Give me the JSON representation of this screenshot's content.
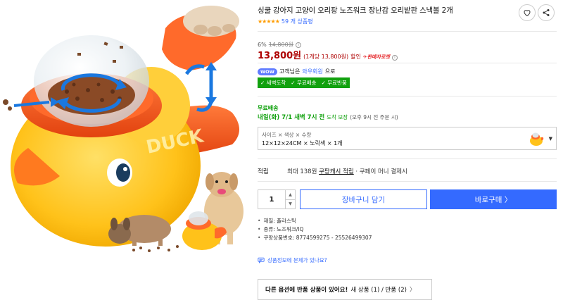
{
  "product": {
    "title": "싱쿨 강아지 고양이 오리팡 노즈워크 장난감 오리밭판 스낵볼 2개",
    "rating_stars": "★★★★★",
    "review_count": "59 개 상품평"
  },
  "icons": {
    "wishlist": "heart-icon",
    "share": "share-icon",
    "info": "info-icon",
    "chevron": "chevron-right-icon",
    "report": "chat-icon"
  },
  "price": {
    "discount_rate": "6%",
    "original_price": "14,800원",
    "sale_price": "13,800원",
    "unit_price": "(1개당 13,800원)",
    "discount_word": "할인",
    "rocket_badge": "✈판매자로켓"
  },
  "wow": {
    "badge": "WOW",
    "prefix": "고객님은",
    "link": "와우회원",
    "suffix": "으로"
  },
  "benefits": [
    "새벽도착",
    "무료배송",
    "무료반품"
  ],
  "shipping": {
    "label": "무료배송",
    "date": "내일(화) 7/1 새벽 7시 전",
    "guarantee": "도착 보장",
    "condition": "(오후 9시 전 주문 시)"
  },
  "option": {
    "header": "사이즈 × 색상 × 수량",
    "value": "12×12×24CM × 노락색 × 1개"
  },
  "cashback": {
    "label": "적립",
    "prefix": "최대 138원",
    "link": "쿠팡캐시 적립",
    "suffix": "· 쿠페이 머니 결제시"
  },
  "purchase": {
    "quantity": "1",
    "cart_label": "장바구니 담기",
    "buy_label": "바로구매 〉"
  },
  "specs": [
    "재질: 플라스틱",
    "종류: 노즈워크/IQ",
    "쿠팡상품번호: 8774599275 - 25526499307"
  ],
  "report_text": "상품정보에 문제가 있나요?",
  "other_options": {
    "bold_text": "다른 옵션에 반품 상품이 있어요!",
    "detail": "새 상품 (1) / 반품 (2)",
    "caret": "〉"
  },
  "image_text": {
    "duck_label": "DUCK"
  },
  "colors": {
    "price_red": "#ae0000",
    "link_blue": "#346aff",
    "rocket_green": "#11a10e",
    "duck_yellow": "#ffc21a",
    "duck_orange": "#ff5a1f"
  }
}
